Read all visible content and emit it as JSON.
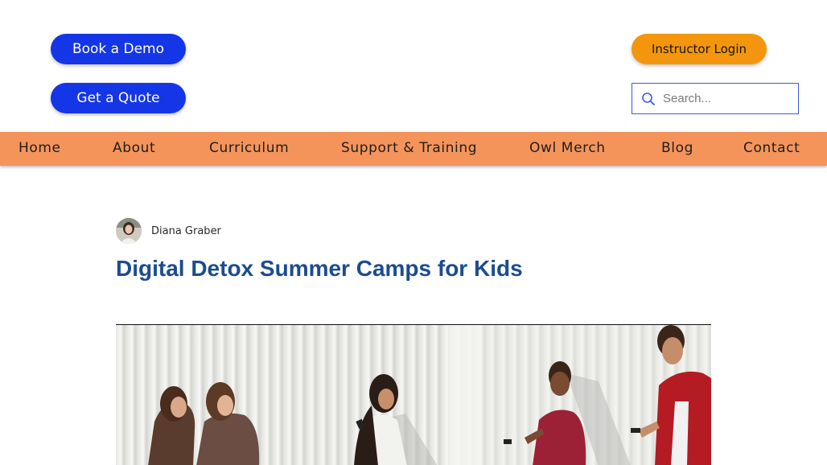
{
  "header": {
    "book_demo_label": "Book a Demo",
    "get_quote_label": "Get a Quote",
    "instructor_login_label": "Instructor Login",
    "search": {
      "placeholder": "Search...",
      "value": ""
    }
  },
  "nav": {
    "items": [
      {
        "label": "Home"
      },
      {
        "label": "About"
      },
      {
        "label": "Curriculum"
      },
      {
        "label": "Support & Training"
      },
      {
        "label": "Owl Merch"
      },
      {
        "label": "Blog"
      },
      {
        "label": "Contact"
      }
    ]
  },
  "post": {
    "author": "Diana Graber",
    "title": "Digital Detox Summer Camps for Kids"
  },
  "colors": {
    "primary_button": "#1536e6",
    "login_button": "#f3960d",
    "nav_background": "#f5945a",
    "title": "#1b4c8e"
  },
  "icons": {
    "search": "magnifier-icon"
  }
}
